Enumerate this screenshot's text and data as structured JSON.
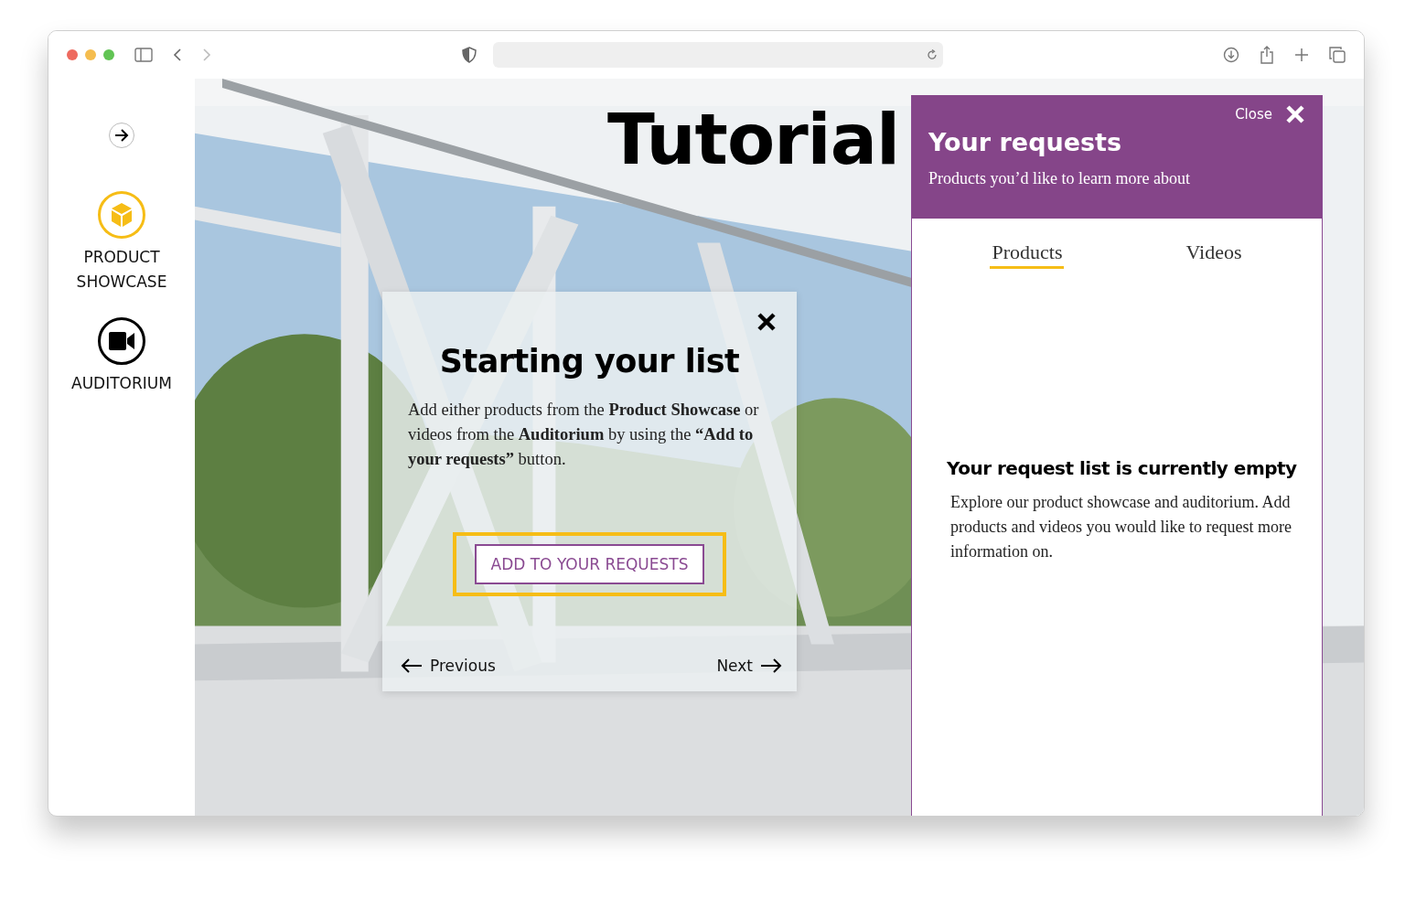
{
  "sidebar": {
    "items": [
      {
        "label": "PRODUCT SHOWCASE",
        "kind": "showcase",
        "selected": true
      },
      {
        "label": "AUDITORIUM",
        "kind": "auditorium",
        "selected": false
      }
    ]
  },
  "page_title": "Tutorial",
  "tutorial_dialog": {
    "title": "Starting your list",
    "body": "Add either products from the **Product Showcase** or videos from the **Auditorium** by using the **“Add to your requests”** button.",
    "button": "ADD TO YOUR REQUESTS",
    "previous": "Previous",
    "next": "Next"
  },
  "requests_panel": {
    "close": "Close",
    "title": "Your requests",
    "subtitle": "Products you’d like to learn more about",
    "tabs": [
      {
        "label": "Products",
        "selected": true
      },
      {
        "label": "Videos",
        "selected": false
      }
    ],
    "empty_title": "Your request list is currently empty",
    "empty_text": "Explore our product showcase and auditorium. Add products and videos you would like to request more information on."
  }
}
